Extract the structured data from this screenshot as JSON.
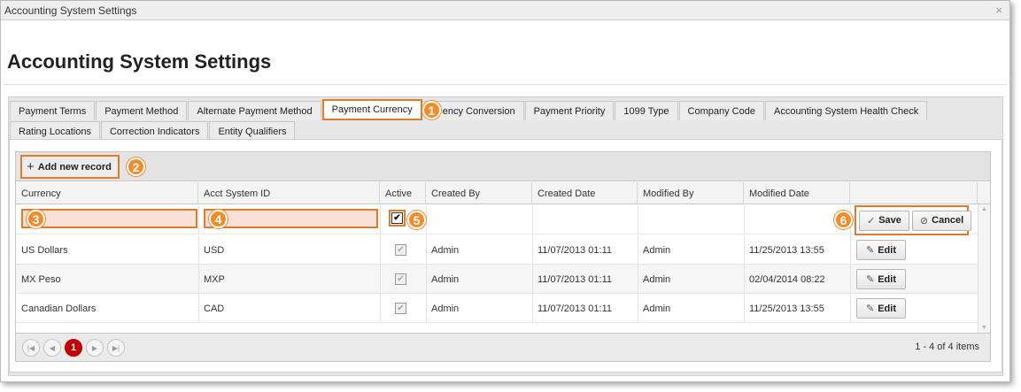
{
  "window": {
    "title": "Accounting System Settings",
    "close": "×"
  },
  "page": {
    "heading": "Accounting System Settings"
  },
  "tabs_row1": [
    "Payment Terms",
    "Payment Method",
    "Alternate Payment Method",
    "Payment Currency",
    "ency Conversion",
    "Payment Priority",
    "1099 Type",
    "Company Code",
    "Accounting System Health Check"
  ],
  "tabs_row2": [
    "Rating Locations",
    "Correction Indicators",
    "Entity Qualifiers"
  ],
  "toolbar": {
    "add_label": "Add new record"
  },
  "columns": [
    "Currency",
    "Acct System ID",
    "Active",
    "Created By",
    "Created Date",
    "Modified By",
    "Modified Date"
  ],
  "edit_row": {
    "save": "Save",
    "cancel": "Cancel"
  },
  "rows": [
    {
      "currency": "US Dollars",
      "acct_id": "USD",
      "created_by": "Admin",
      "created_date": "11/07/2013 01:11",
      "modified_by": "Admin",
      "modified_date": "11/25/2013 13:55",
      "edit": "Edit"
    },
    {
      "currency": "MX Peso",
      "acct_id": "MXP",
      "created_by": "Admin",
      "created_date": "11/07/2013 01:11",
      "modified_by": "Admin",
      "modified_date": "02/04/2014 08:22",
      "edit": "Edit"
    },
    {
      "currency": "Canadian Dollars",
      "acct_id": "CAD",
      "created_by": "Admin",
      "created_date": "11/07/2013 01:11",
      "modified_by": "Admin",
      "modified_date": "11/25/2013 13:55",
      "edit": "Edit"
    }
  ],
  "pager": {
    "current_page": "1",
    "info": "1 - 4 of 4 items"
  },
  "badges": [
    "1",
    "2",
    "3",
    "4",
    "5",
    "6"
  ],
  "colors": {
    "highlight": "#e07a2c",
    "badge": "#f08c2c",
    "current_page": "#c00000"
  },
  "icons": {
    "add": "plus-icon",
    "save": "check-icon",
    "cancel": "cancel-circle-icon",
    "edit": "pencil-icon"
  }
}
